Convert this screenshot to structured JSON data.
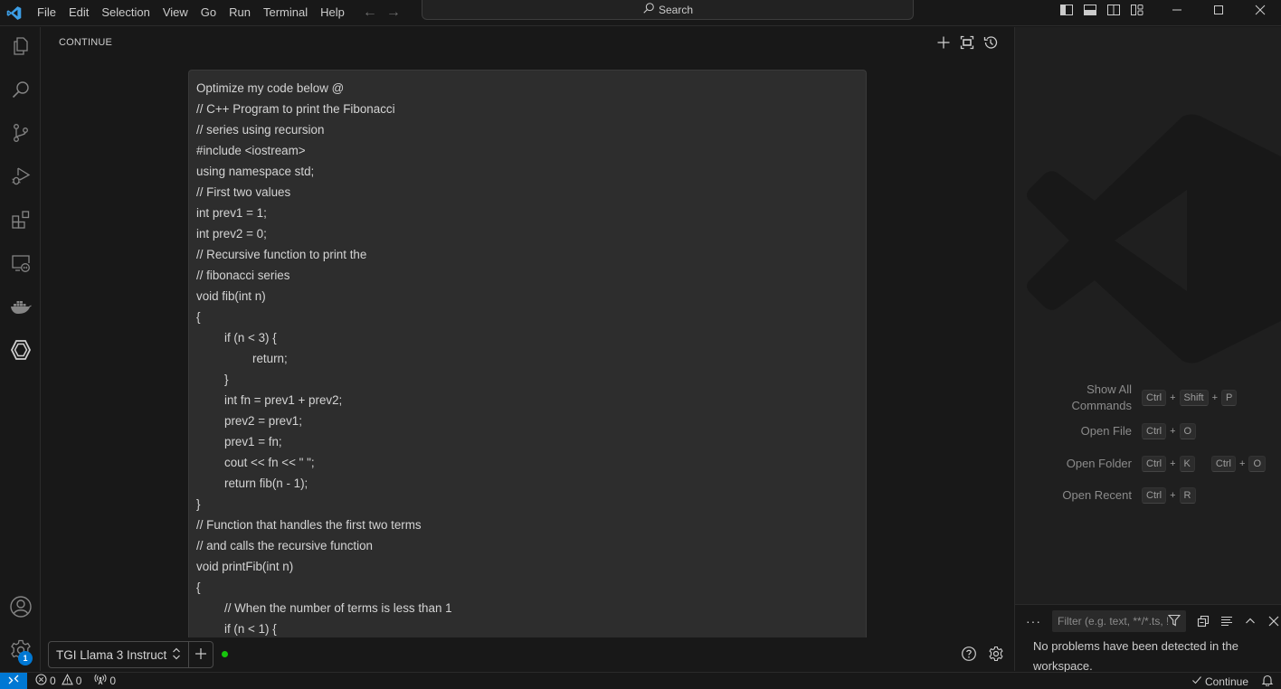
{
  "titlebar": {
    "menu": [
      "File",
      "Edit",
      "Selection",
      "View",
      "Go",
      "Run",
      "Terminal",
      "Help"
    ],
    "search_label": "Search",
    "accent": "#0078d4"
  },
  "activity_bar": {
    "items": [
      {
        "name": "explorer",
        "icon": "files-icon"
      },
      {
        "name": "search",
        "icon": "search-icon"
      },
      {
        "name": "source-control",
        "icon": "source-control-icon"
      },
      {
        "name": "run-debug",
        "icon": "run-debug-icon"
      },
      {
        "name": "extensions",
        "icon": "extensions-icon"
      },
      {
        "name": "remote-explorer",
        "icon": "remote-explorer-icon"
      },
      {
        "name": "docker",
        "icon": "docker-icon"
      },
      {
        "name": "continue",
        "icon": "continue-icon"
      }
    ],
    "accounts_icon": "account-icon",
    "manage_icon": "gear-icon",
    "manage_badge": "1"
  },
  "continue_panel": {
    "title": "CONTINUE",
    "actions": [
      "new-session-icon",
      "fullscreen-icon",
      "history-icon"
    ],
    "prompt_lines": [
      {
        "text": "Optimize my code below @",
        "indent": 0
      },
      {
        "text": "// C++ Program to print the Fibonacci",
        "indent": 0
      },
      {
        "text": "// series using recursion",
        "indent": 0
      },
      {
        "text": "#include <iostream>",
        "indent": 0
      },
      {
        "text": "using namespace std;",
        "indent": 0
      },
      {
        "text": "// First two values",
        "indent": 0
      },
      {
        "text": "int prev1 = 1;",
        "indent": 0
      },
      {
        "text": "int prev2 = 0;",
        "indent": 0
      },
      {
        "text": "// Recursive function to print the",
        "indent": 0
      },
      {
        "text": "// fibonacci series",
        "indent": 0
      },
      {
        "text": "void fib(int n)",
        "indent": 0
      },
      {
        "text": "{",
        "indent": 0
      },
      {
        "text": "if (n < 3) {",
        "indent": 1
      },
      {
        "text": "return;",
        "indent": 2
      },
      {
        "text": "}",
        "indent": 1
      },
      {
        "text": "int fn = prev1 + prev2;",
        "indent": 1
      },
      {
        "text": "prev2 = prev1;",
        "indent": 1
      },
      {
        "text": "prev1 = fn;",
        "indent": 1
      },
      {
        "text": "cout << fn << \" \";",
        "indent": 1
      },
      {
        "text": "return fib(n - 1);",
        "indent": 1
      },
      {
        "text": "}",
        "indent": 0
      },
      {
        "text": "// Function that handles the first two terms",
        "indent": 0
      },
      {
        "text": "// and calls the recursive function",
        "indent": 0
      },
      {
        "text": "void printFib(int n)",
        "indent": 0
      },
      {
        "text": "{",
        "indent": 0
      },
      {
        "text": "// When the number of terms is less than 1",
        "indent": 1
      },
      {
        "text": "if (n < 1) {",
        "indent": 1
      }
    ],
    "model_name": "TGI Llama 3 Instruct",
    "status_color": "#16c60c"
  },
  "editor_welcome": {
    "shortcuts": [
      {
        "label": "Show All Commands",
        "groups": [
          [
            "Ctrl",
            "Shift",
            "P"
          ]
        ]
      },
      {
        "label": "Open File",
        "groups": [
          [
            "Ctrl",
            "O"
          ]
        ]
      },
      {
        "label": "Open Folder",
        "groups": [
          [
            "Ctrl",
            "K"
          ],
          [
            "Ctrl",
            "O"
          ]
        ]
      },
      {
        "label": "Open Recent",
        "groups": [
          [
            "Ctrl",
            "R"
          ]
        ]
      }
    ]
  },
  "problems_panel": {
    "filter_placeholder": "Filter (e.g. text, **/*.ts, !**/node_modules/**)",
    "message": "No problems have been detected in the workspace."
  },
  "statusbar": {
    "errors": "0",
    "warnings": "0",
    "ports": "0",
    "continue_label": "Continue"
  }
}
